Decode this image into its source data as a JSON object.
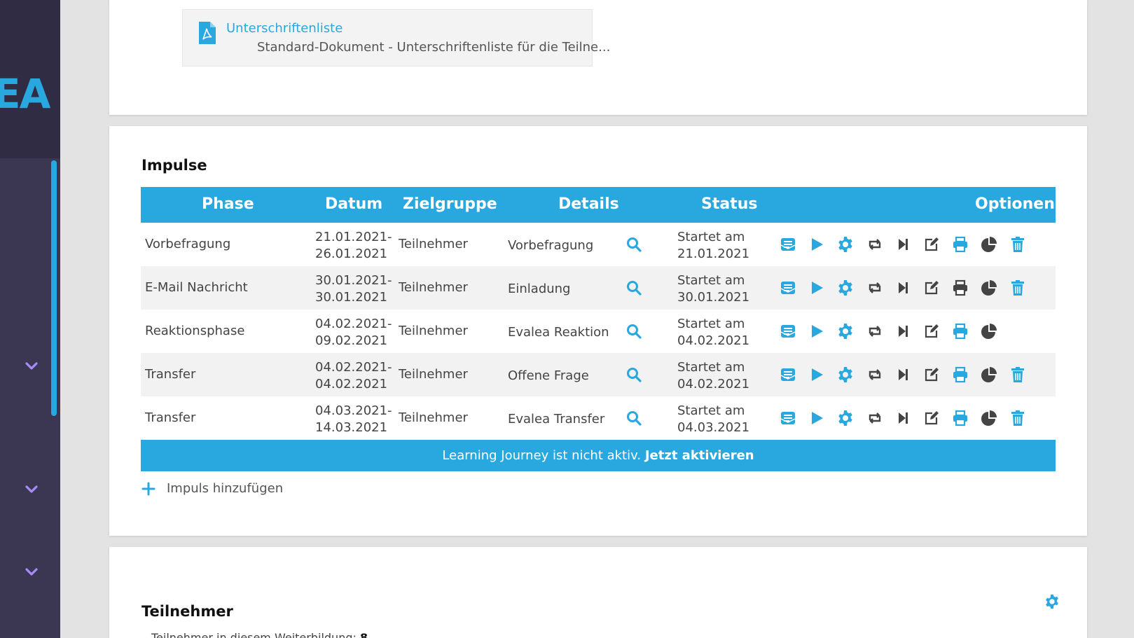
{
  "sidebar": {
    "logo_text": "EA",
    "accent": "#29a8e0",
    "chevrons": [
      "chevron-down-icon",
      "chevron-down-icon",
      "chevron-down-icon"
    ]
  },
  "document": {
    "title": "Unterschriftenliste",
    "subtitle": "Standard-Dokument - Unterschriftenliste für die Teilne...",
    "icon": "pdf-file-icon"
  },
  "impulse": {
    "title": "Impulse",
    "headers": {
      "phase": "Phase",
      "datum": "Datum",
      "zielgruppe": "Zielgruppe",
      "details": "Details",
      "status": "Status",
      "optionen": "Optionen"
    },
    "rows": [
      {
        "phase": "Vorbefragung",
        "date_from": "21.01.2021-",
        "date_to": "26.01.2021",
        "zielgruppe": "Teilnehmer",
        "details": "Vorbefragung",
        "status_line1": "Startet am",
        "status_line2": "21.01.2021",
        "print_active": true,
        "has_delete": true
      },
      {
        "phase": "E-Mail Nachricht",
        "date_from": "30.01.2021-",
        "date_to": "30.01.2021",
        "zielgruppe": "Teilnehmer",
        "details": "Einladung",
        "status_line1": "Startet am",
        "status_line2": "30.01.2021",
        "print_active": false,
        "has_delete": true
      },
      {
        "phase": "Reaktionsphase",
        "date_from": "04.02.2021-",
        "date_to": "09.02.2021",
        "zielgruppe": "Teilnehmer",
        "details": "Evalea Reaktion",
        "status_line1": "Startet am",
        "status_line2": "04.02.2021",
        "print_active": true,
        "has_delete": false
      },
      {
        "phase": "Transfer",
        "date_from": "04.02.2021-",
        "date_to": "04.02.2021",
        "zielgruppe": "Teilnehmer",
        "details": "Offene Frage",
        "status_line1": "Startet am",
        "status_line2": "04.02.2021",
        "print_active": true,
        "has_delete": true
      },
      {
        "phase": "Transfer",
        "date_from": "04.03.2021-",
        "date_to": "14.03.2021",
        "zielgruppe": "Teilnehmer",
        "details": "Evalea Transfer",
        "status_line1": "Startet am",
        "status_line2": "04.03.2021",
        "print_active": true,
        "has_delete": true
      }
    ],
    "banner_text": "Learning Journey ist nicht aktiv.",
    "banner_link": "Jetzt aktivieren",
    "add_label": "Impuls hinzufügen"
  },
  "teilnehmer": {
    "title": "Teilnehmer",
    "count_label": "Teilnehmer in diesem Weiterbildung:",
    "count_value": "8"
  }
}
